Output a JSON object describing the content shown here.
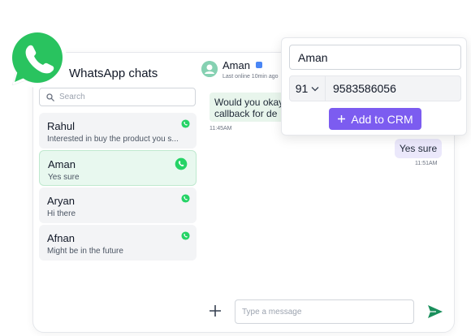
{
  "sidebar": {
    "title": "WhatsApp chats",
    "search_placeholder": "Search",
    "chats": [
      {
        "name": "Rahul",
        "preview": "Interested in buy the product you s..."
      },
      {
        "name": "Aman",
        "preview": "Yes sure"
      },
      {
        "name": "Aryan",
        "preview": "Hi there"
      },
      {
        "name": "Afnan",
        "preview": "Might be in the future"
      }
    ]
  },
  "conversation": {
    "contact_name": "Aman",
    "status": "Last online 10min ago",
    "messages": [
      {
        "direction": "incoming",
        "lines": [
          "Would you okay",
          "callback for de"
        ],
        "time": "11:45AM"
      },
      {
        "direction": "outgoing",
        "text": "Yes sure",
        "time": "11:51AM"
      }
    ],
    "input_placeholder": "Type a message"
  },
  "crm_panel": {
    "name_value": "Aman",
    "country_code": "91",
    "phone_value": "9583586056",
    "add_button_label": "Add to CRM"
  },
  "colors": {
    "whatsapp_green": "#25d366",
    "brand_purple": "#7c5cf0",
    "send_green": "#1a8f5c",
    "active_chat_bg": "#e8f8ef",
    "incoming_bubble": "#e8f5ec",
    "outgoing_bubble": "#ebe8fb"
  },
  "icons": {
    "logo": "whatsapp-logo-icon",
    "search": "search-icon",
    "chat_badge": "whatsapp-icon",
    "verified": "verified-badge-icon",
    "dropdown": "chevron-down-icon",
    "add": "plus-icon",
    "attach": "plus-icon",
    "send": "send-icon"
  }
}
